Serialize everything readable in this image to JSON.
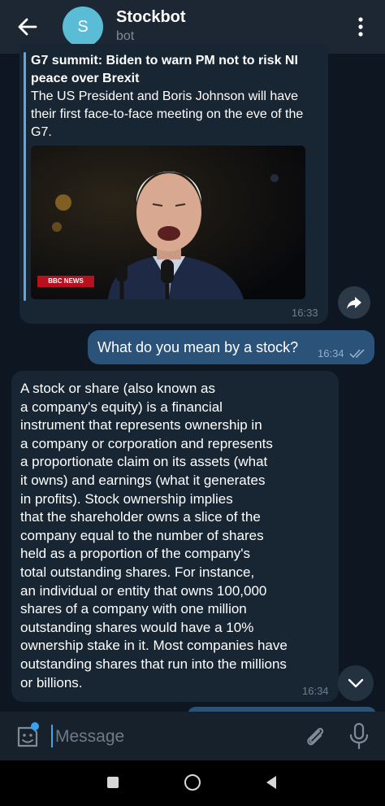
{
  "header": {
    "avatar_letter": "S",
    "title": "Stockbot",
    "subtitle": "bot",
    "icons": [
      "arrow-left-icon",
      "more-vertical-icon"
    ]
  },
  "messages": [
    {
      "type": "link_preview",
      "direction": "incoming",
      "title": "G7 summit: Biden to warn PM not to risk NI peace over Brexit",
      "description": "The US President and Boris Johnson will have their first face-to-face meeting on the eve of the G7.",
      "image_badge": "BBC NEWS",
      "time": "16:33"
    },
    {
      "type": "text",
      "direction": "outgoing",
      "text": "What do you mean by a stock?",
      "time": "16:34",
      "status": "read"
    },
    {
      "type": "text",
      "direction": "incoming",
      "lines": [
        "A stock or share (also known as",
        "a company's equity) is a financial",
        "instrument that represents ownership in",
        "a company or corporation and represents",
        "a proportionate claim on its assets (what",
        "it owns) and earnings (what it generates",
        "in profits). Stock ownership implies",
        "that the shareholder owns a slice of the",
        "company equal to the number of shares",
        "held as a proportion of the company's",
        "total outstanding shares. For instance,",
        "an individual or entity that owns 100,000",
        "shares of a company with one million",
        "outstanding shares would have a 10%",
        "ownership stake in it. Most companies have",
        "outstanding shares that run into the millions",
        "or billions."
      ],
      "time": "16:34"
    }
  ],
  "input": {
    "placeholder": "Message",
    "value": ""
  },
  "colors": {
    "background": "#0e1621",
    "header": "#1c2733",
    "incoming_bubble": "#182533",
    "outgoing_bubble": "#2b5278",
    "accent": "#5bbcd6"
  }
}
